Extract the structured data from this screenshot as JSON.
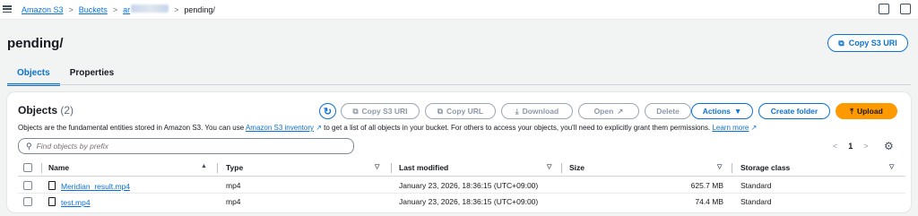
{
  "breadcrumb": {
    "items": [
      "Amazon S3",
      "Buckets",
      "ar",
      "pending/"
    ]
  },
  "page": {
    "title": "pending/",
    "copy_uri_label": "Copy S3 URI"
  },
  "tabs": [
    {
      "label": "Objects",
      "active": true
    },
    {
      "label": "Properties",
      "active": false
    }
  ],
  "objects_panel": {
    "title": "Objects",
    "count": "(2)",
    "description_prefix": "Objects are the fundamental entities stored in Amazon S3. You can use ",
    "inventory_link": "Amazon S3 inventory",
    "description_suffix": " to get a list of all objects in your bucket. For others to access your objects, you'll need to explicitly grant them permissions. ",
    "learn_more": "Learn more",
    "buttons": {
      "copy_s3_uri": "Copy S3 URI",
      "copy_url": "Copy URL",
      "download": "Download",
      "open": "Open",
      "delete": "Delete",
      "actions": "Actions",
      "create_folder": "Create folder",
      "upload": "Upload"
    },
    "search_placeholder": "Find objects by prefix",
    "page_number": "1"
  },
  "table": {
    "columns": [
      "Name",
      "Type",
      "Last modified",
      "Size",
      "Storage class"
    ],
    "rows": [
      {
        "name": "Meridian_result.mp4",
        "type": "mp4",
        "last_modified": "January 23, 2026, 18:36:15 (UTC+09:00)",
        "size": "625.7 MB",
        "storage_class": "Standard"
      },
      {
        "name": "test.mp4",
        "type": "mp4",
        "last_modified": "January 23, 2026, 18:36:15 (UTC+09:00)",
        "size": "74.4 MB",
        "storage_class": "Standard"
      }
    ]
  },
  "colors": {
    "accent": "#0972d3",
    "upload": "#ff9900"
  }
}
